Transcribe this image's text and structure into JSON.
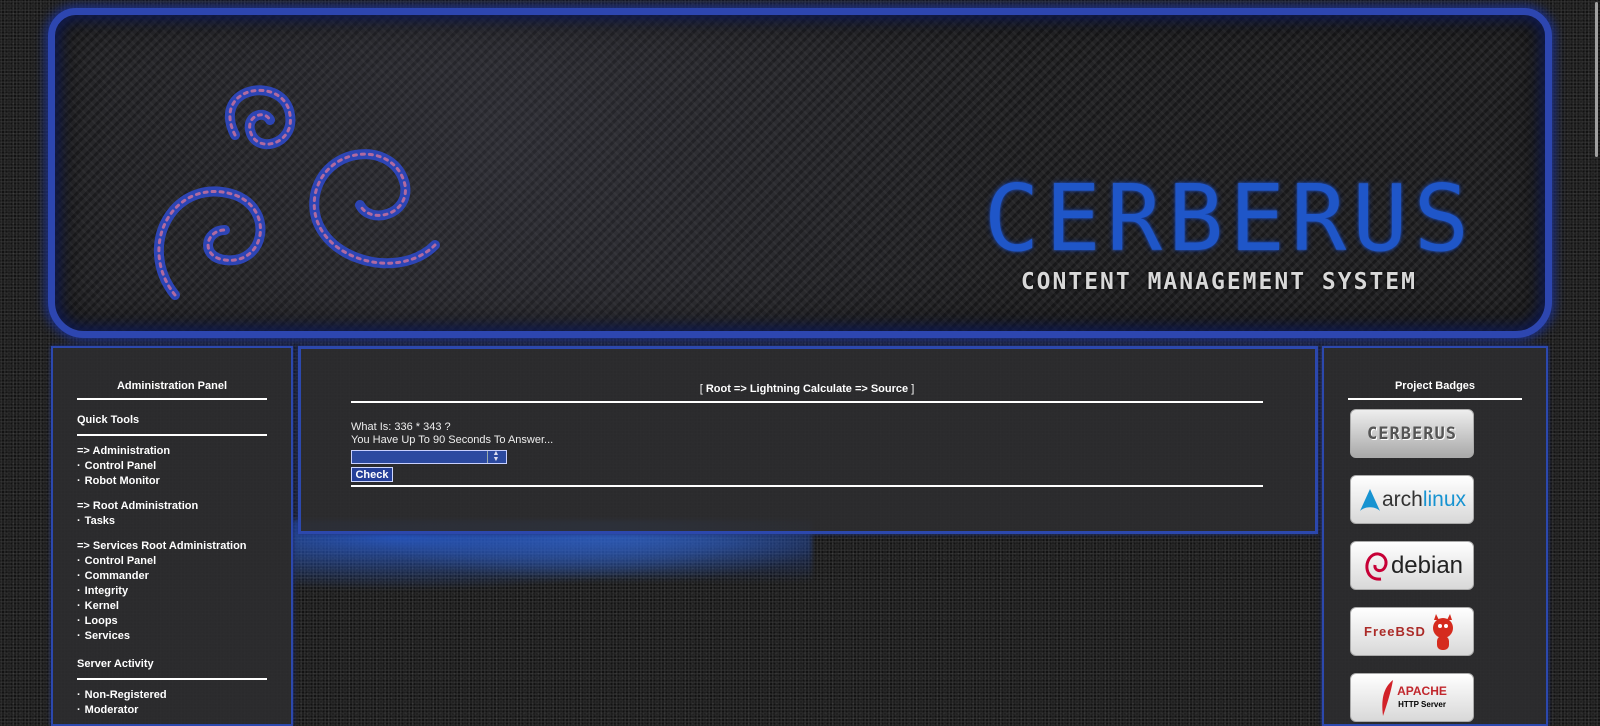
{
  "banner": {
    "title": "CERBERUS",
    "subtitle": "CONTENT MANAGEMENT SYSTEM"
  },
  "left_panel": {
    "title": "Administration Panel",
    "quick_tools": "Quick Tools",
    "groups": [
      {
        "heading": "=> Administration",
        "items": [
          "Control Panel",
          "Robot Monitor"
        ]
      },
      {
        "heading": "=> Root Administration",
        "items": [
          "Tasks"
        ]
      },
      {
        "heading": "=> Services Root Administration",
        "items": [
          "Control Panel",
          "Commander",
          "Integrity",
          "Kernel",
          "Loops",
          "Services"
        ]
      }
    ],
    "server_activity": "Server Activity",
    "activity_items": [
      "Non-Registered",
      "Moderator"
    ],
    "bullet": "·"
  },
  "main": {
    "breadcrumb_open": "[",
    "breadcrumb": "Root => Lightning Calculate => Source",
    "breadcrumb_close": "]",
    "question": "What Is: 336 * 343 ?",
    "time_note": "You Have Up To 90 Seconds To Answer...",
    "answer_value": "",
    "check_label": "Check"
  },
  "right_panel": {
    "title": "Project Badges",
    "badges": [
      {
        "name": "CERBERUS"
      },
      {
        "name": "archlinux",
        "prefix": "arch",
        "suffix": "linux"
      },
      {
        "name": "debian"
      },
      {
        "name": "FreeBSD"
      },
      {
        "name": "APACHE",
        "sub": "HTTP Server"
      }
    ]
  },
  "colors": {
    "accent_blue": "#2c48ad",
    "title_blue": "#1f56c8",
    "panel_bg": "#2d2d2f"
  }
}
